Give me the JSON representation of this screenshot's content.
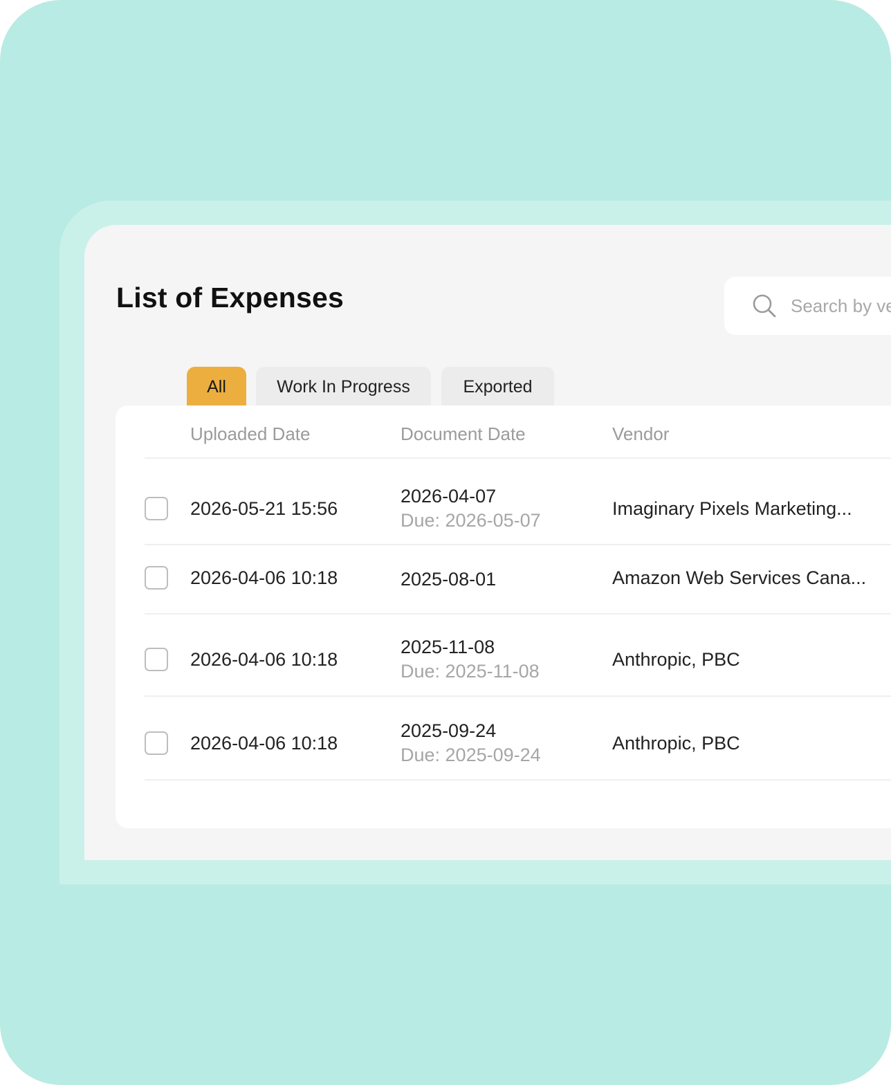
{
  "page": {
    "title": "List of Expenses"
  },
  "search": {
    "placeholder": "Search by vendor"
  },
  "tabs": [
    {
      "label": "All",
      "active": true
    },
    {
      "label": "Work In Progress",
      "active": false
    },
    {
      "label": "Exported",
      "active": false
    }
  ],
  "table": {
    "headers": {
      "uploaded_date": "Uploaded Date",
      "document_date": "Document Date",
      "vendor": "Vendor"
    },
    "rows": [
      {
        "uploaded": "2026-05-21 15:56",
        "document_date": "2026-04-07",
        "due": "Due: 2026-05-07",
        "vendor": "Imaginary Pixels Marketing...",
        "checked": false
      },
      {
        "uploaded": "2026-04-06 10:18",
        "document_date": "2025-08-01",
        "due": "",
        "vendor": "Amazon Web Services Cana...",
        "checked": false
      },
      {
        "uploaded": "2026-04-06 10:18",
        "document_date": "2025-11-08",
        "due": "Due: 2025-11-08",
        "vendor": "Anthropic, PBC",
        "checked": false
      },
      {
        "uploaded": "2026-04-06 10:18",
        "document_date": "2025-09-24",
        "due": "Due: 2025-09-24",
        "vendor": "Anthropic, PBC",
        "checked": false
      }
    ]
  },
  "colors": {
    "background": "#b8ebe3",
    "panel": "#f5f5f5",
    "accent_tab": "#edae40",
    "muted_text": "#a6a6a6"
  },
  "icons": {
    "search": "search-icon",
    "checkbox": "checkbox-unchecked-icon"
  }
}
